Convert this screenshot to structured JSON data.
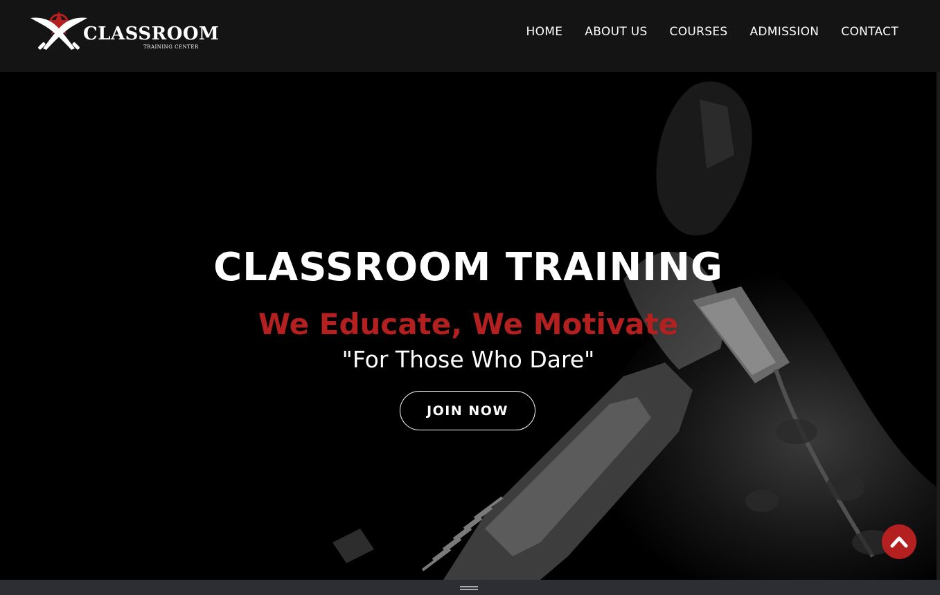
{
  "header": {
    "logo": {
      "word": "CLASSROOM",
      "sub": "TRAINING CENTER"
    },
    "nav": [
      {
        "label": "HOME"
      },
      {
        "label": "ABOUT US"
      },
      {
        "label": "COURSES"
      },
      {
        "label": "ADMISSION"
      },
      {
        "label": "CONTACT"
      }
    ]
  },
  "hero": {
    "title": "CLASSROOM TRAINING",
    "tagline": "We Educate, We Motivate",
    "quote": "\"For Those Who Dare\"",
    "cta_label": "JOIN NOW"
  },
  "icons": {
    "logo": "crossed-kukri-knives-star-icon",
    "scroll_top": "chevron-up-icon",
    "resize": "resize-grip-icon"
  },
  "colors": {
    "header_bg": "#141414",
    "accent_red": "#b3201f",
    "text_white": "#ffffff",
    "bottom_bar": "#2c2e33"
  }
}
